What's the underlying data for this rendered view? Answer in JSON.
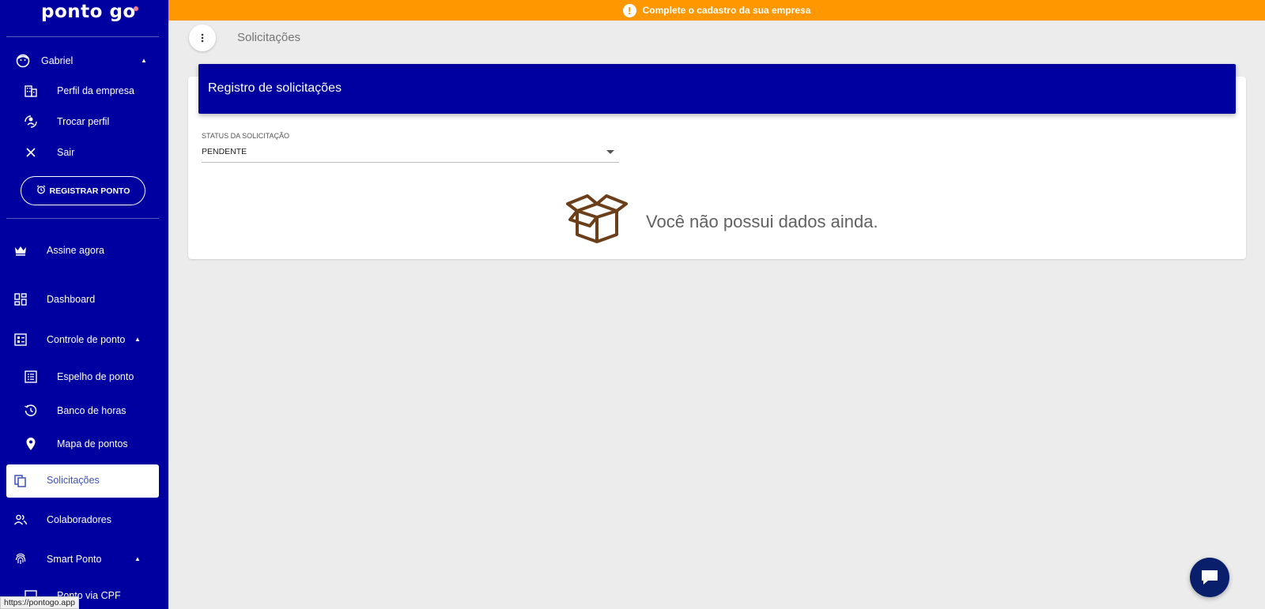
{
  "sidebar": {
    "logo": "ponto go",
    "user": {
      "name": "Gabriel"
    },
    "user_menu": [
      {
        "label": "Perfil da empresa",
        "icon": "building-icon"
      },
      {
        "label": "Trocar perfil",
        "icon": "swap-profile-icon"
      },
      {
        "label": "Sair",
        "icon": "close-icon"
      }
    ],
    "register_button": "REGISTRAR PONTO",
    "nav": {
      "subscribe": "Assine agora",
      "dashboard": "Dashboard",
      "time_control": "Controle de ponto",
      "time_control_items": [
        {
          "label": "Espelho de ponto",
          "icon": "list-icon"
        },
        {
          "label": "Banco de horas",
          "icon": "history-icon"
        },
        {
          "label": "Mapa de pontos",
          "icon": "map-pin-icon"
        }
      ],
      "requests": "Solicitações",
      "employees": "Colaboradores",
      "smart_ponto": "Smart Ponto",
      "smart_items": [
        {
          "label": "Ponto via CPF"
        }
      ]
    }
  },
  "banner": {
    "text": "Complete o cadastro da sua empresa"
  },
  "toolbar": {
    "title": "Solicitações"
  },
  "card": {
    "title": "Registro de solicitações",
    "status_label": "STATUS DA SOLICITAÇÃO",
    "status_value": "PENDENTE",
    "empty_text": "Você não possui dados ainda."
  },
  "statusbar": {
    "url": "https://pontogo.app"
  },
  "colors": {
    "sidebar_bg": "#0000a0",
    "banner_bg": "#ff9800",
    "page_bg": "#ececec",
    "empty_icon": "#6b3f1a",
    "chat_button": "#0a1f6b"
  }
}
